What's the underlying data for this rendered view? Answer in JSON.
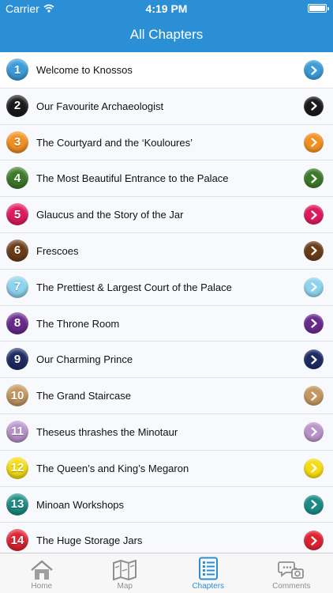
{
  "status": {
    "carrier": "Carrier",
    "time": "4:19 PM"
  },
  "header": {
    "title": "All Chapters"
  },
  "chapters": [
    {
      "number": "1",
      "title": "Welcome to Knossos",
      "color": "#3c9bd8"
    },
    {
      "number": "2",
      "title": "Our Favourite Archaeologist",
      "color": "#1a1a1a"
    },
    {
      "number": "3",
      "title": "The Courtyard and the ‘Kouloures’",
      "color": "#f39022"
    },
    {
      "number": "4",
      "title": "The Most Beautiful Entrance to the Palace",
      "color": "#3c7a2a"
    },
    {
      "number": "5",
      "title": "Glaucus and the Story of the Jar",
      "color": "#e01a5c"
    },
    {
      "number": "6",
      "title": "Frescoes",
      "color": "#6b3c18"
    },
    {
      "number": "7",
      "title": "The Prettiest & Largest Court of the Palace",
      "color": "#8ed3ee"
    },
    {
      "number": "8",
      "title": "The Throne Room",
      "color": "#682b8c"
    },
    {
      "number": "9",
      "title": "Our Charming Prince",
      "color": "#1d2b63"
    },
    {
      "number": "10",
      "title": "The Grand Staircase",
      "color": "#c3975f"
    },
    {
      "number": "11",
      "title": "Theseus thrashes the Minotaur",
      "color": "#b993c9"
    },
    {
      "number": "12",
      "title": "The Queen’s and King’s Megaron",
      "color": "#f5dc12"
    },
    {
      "number": "13",
      "title": "Minoan Workshops",
      "color": "#1b8b84"
    },
    {
      "number": "14",
      "title": "The Huge Storage Jars",
      "color": "#df2232"
    }
  ],
  "tabs": [
    {
      "label": "Home",
      "icon": "home-icon",
      "active": false
    },
    {
      "label": "Map",
      "icon": "map-icon",
      "active": false
    },
    {
      "label": "Chapters",
      "icon": "chapters-icon",
      "active": true
    },
    {
      "label": "Comments",
      "icon": "comments-icon",
      "active": false
    }
  ],
  "colors": {
    "accent": "#2b8fd6",
    "tab_inactive": "#8f8f8f"
  }
}
